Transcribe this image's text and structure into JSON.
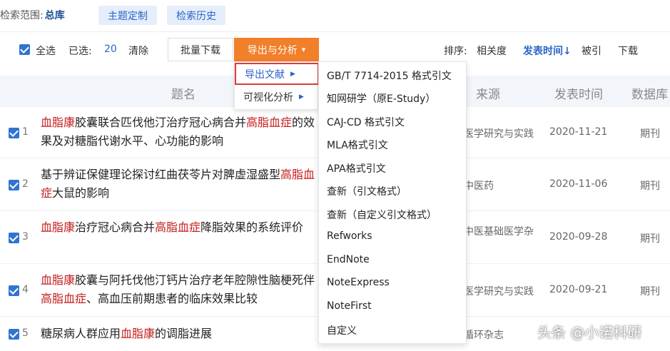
{
  "scope": {
    "label": "检索范围:",
    "value": "总库"
  },
  "tags": {
    "topic": "主题定制",
    "history": "检索历史"
  },
  "toolbar": {
    "select_all": "全选",
    "selected_label": "已选:",
    "selected_count": "20",
    "clear": "清除",
    "batch_download": "批量下载",
    "export_analyze": "导出与分析",
    "sort_label": "排序:",
    "sort_relevance": "相关度",
    "sort_date": "发表时间",
    "sort_date_arrow": "↓",
    "sort_cited": "被引",
    "sort_download": "下载"
  },
  "table": {
    "headers": {
      "title": "题名",
      "source": "来源",
      "date": "发表时间",
      "database": "数据库"
    },
    "rows": [
      {
        "num": "1",
        "title_parts": [
          {
            "t": "血脂康",
            "hl": true
          },
          {
            "t": "胶囊联合匹伐他汀治疗冠心病合并",
            "hl": false
          },
          {
            "t": "高脂血症",
            "hl": true
          },
          {
            "t": "的效果及对糖脂代谢水平、心功能的影响",
            "hl": false
          }
        ],
        "source": "医学研究与实践",
        "date": "2020-11-21",
        "database": "期刊"
      },
      {
        "num": "2",
        "title_parts": [
          {
            "t": "基于辨证保健理论探讨红曲茯苓片对脾虚湿盛型",
            "hl": false
          },
          {
            "t": "高脂血症",
            "hl": true
          },
          {
            "t": "大鼠的影响",
            "hl": false
          }
        ],
        "source": "中医药",
        "date": "2020-11-06",
        "database": "期刊"
      },
      {
        "num": "3",
        "title_parts": [
          {
            "t": "血脂康",
            "hl": true
          },
          {
            "t": "治疗冠心病合并",
            "hl": false
          },
          {
            "t": "高脂血症",
            "hl": true
          },
          {
            "t": "降脂效果的系统评价",
            "hl": false
          }
        ],
        "source": "中医基础医学杂",
        "date": "2020-09-28",
        "database": "期刊"
      },
      {
        "num": "4",
        "title_parts": [
          {
            "t": "血脂康",
            "hl": true
          },
          {
            "t": "胶囊与阿托伐他汀钙片治疗老年腔隙性脑梗死伴",
            "hl": false
          },
          {
            "t": "高脂血症",
            "hl": true
          },
          {
            "t": "、高血压前期患者的临床效果比较",
            "hl": false
          }
        ],
        "source": "医学研究与实践",
        "date": "2020-09-21",
        "database": "期刊"
      },
      {
        "num": "5",
        "title_parts": [
          {
            "t": "糖尿病人群应用",
            "hl": false
          },
          {
            "t": "血脂康",
            "hl": true
          },
          {
            "t": "的调脂进展",
            "hl": false
          }
        ],
        "source": "循环杂志",
        "date": "",
        "database": ""
      }
    ]
  },
  "menu1": {
    "items": [
      {
        "label": "导出文献"
      },
      {
        "label": "可视化分析"
      }
    ]
  },
  "menu2": {
    "items": [
      "GB/T 7714-2015 格式引文",
      "知网研学（原E-Study）",
      "CAJ-CD 格式引文",
      "MLA格式引文",
      "APA格式引文",
      "查新（引文格式）",
      "查新（自定义引文格式）",
      "Refworks",
      "EndNote",
      "NoteExpress",
      "NoteFirst",
      "自定义"
    ]
  },
  "watermark": "头条 @小诺科研",
  "colors": {
    "accent_orange": "#f27f29",
    "link_blue": "#2b64c7",
    "highlight_red": "#c41b1b",
    "checkbox_blue": "#2f74d0"
  }
}
